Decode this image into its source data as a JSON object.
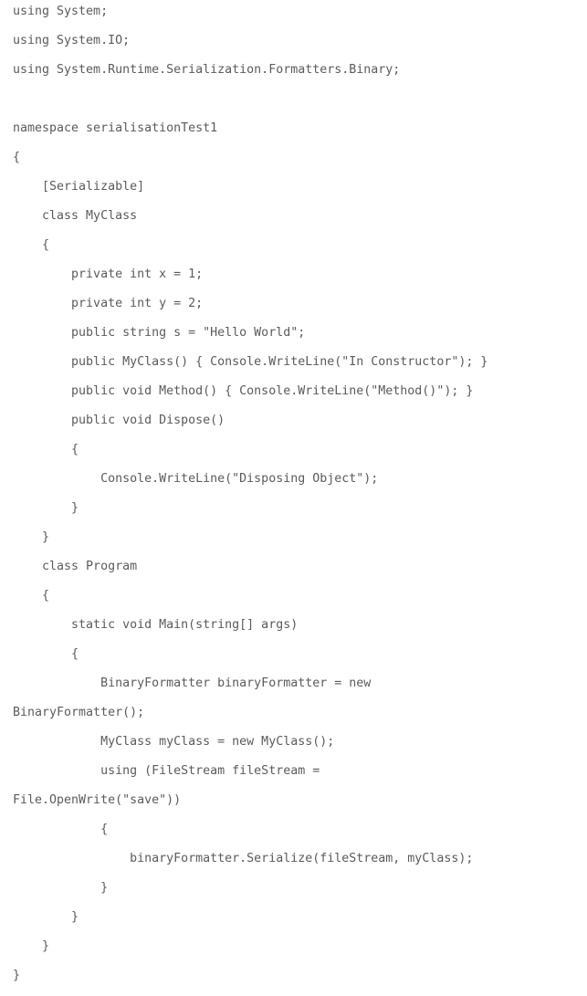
{
  "code": {
    "lines": [
      "using System;",
      "using System.IO;",
      "using System.Runtime.Serialization.Formatters.Binary;",
      "",
      "namespace serialisationTest1",
      "{",
      "    [Serializable]",
      "    class MyClass",
      "    {",
      "        private int x = 1;",
      "        private int y = 2;",
      "        public string s = \"Hello World\";",
      "        public MyClass() { Console.WriteLine(\"In Constructor\"); }",
      "        public void Method() { Console.WriteLine(\"Method()\"); }",
      "        public void Dispose()",
      "        {",
      "            Console.WriteLine(\"Disposing Object\");",
      "        }",
      "    }",
      "    class Program",
      "    {",
      "        static void Main(string[] args)",
      "        {",
      "            BinaryFormatter binaryFormatter = new",
      "BinaryFormatter();",
      "            MyClass myClass = new MyClass();",
      "            using (FileStream fileStream =",
      "File.OpenWrite(\"save\"))",
      "            {",
      "                binaryFormatter.Serialize(fileStream, myClass);",
      "            }",
      "        }",
      "    }",
      "}"
    ]
  }
}
